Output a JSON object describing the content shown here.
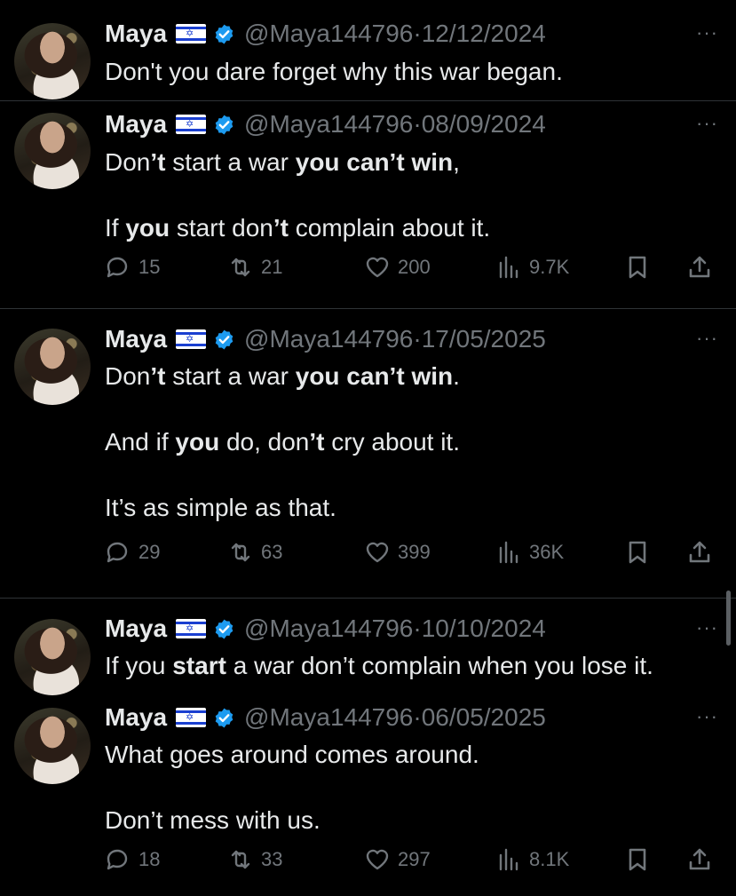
{
  "author": {
    "name": "Maya",
    "flag": "🇮🇱",
    "handle": "@Maya144796"
  },
  "tweets": [
    {
      "date": "12/12/2024",
      "lines": [
        [
          {
            "t": "Don't you dare forget why this war began.",
            "b": false
          }
        ]
      ]
    },
    {
      "date": "08/09/2024",
      "lines": [
        [
          {
            "t": "Don",
            "b": false
          },
          {
            "t": "’t",
            "b": true
          },
          {
            "t": " start a war ",
            "b": false
          },
          {
            "t": "you can’t win",
            "b": true
          },
          {
            "t": ",",
            "b": false
          }
        ],
        [],
        [
          {
            "t": "If ",
            "b": false
          },
          {
            "t": "you",
            "b": true
          },
          {
            "t": " start don",
            "b": false
          },
          {
            "t": "’t",
            "b": true
          },
          {
            "t": " complain about it.",
            "b": false
          }
        ]
      ],
      "stats": {
        "replies": "15",
        "reposts": "21",
        "likes": "200",
        "views": "9.7K"
      }
    },
    {
      "date": "17/05/2025",
      "lines": [
        [
          {
            "t": "Don",
            "b": false
          },
          {
            "t": "’t",
            "b": true
          },
          {
            "t": " start a war ",
            "b": false
          },
          {
            "t": "you can’t win",
            "b": true
          },
          {
            "t": ".",
            "b": false
          }
        ],
        [],
        [
          {
            "t": "And if ",
            "b": false
          },
          {
            "t": "you",
            "b": true
          },
          {
            "t": " do, don",
            "b": false
          },
          {
            "t": "’t",
            "b": true
          },
          {
            "t": " cry about it.",
            "b": false
          }
        ],
        [],
        [
          {
            "t": "It’s as simple as that.",
            "b": false
          }
        ]
      ],
      "stats": {
        "replies": "29",
        "reposts": "63",
        "likes": "399",
        "views": "36K"
      }
    },
    {
      "date": "10/10/2024",
      "lines": [
        [
          {
            "t": "If you ",
            "b": false
          },
          {
            "t": "start",
            "b": true
          },
          {
            "t": " a war don’t complain when you lose it.",
            "b": false
          }
        ]
      ]
    },
    {
      "date": "06/05/2025",
      "lines": [
        [
          {
            "t": "What goes around comes around.",
            "b": false
          }
        ],
        [],
        [
          {
            "t": "Don’t mess with us.",
            "b": false
          }
        ]
      ],
      "stats": {
        "replies": "18",
        "reposts": "33",
        "likes": "297",
        "views": "8.1K"
      }
    }
  ],
  "icons": {
    "verified_color": "#1d9bf0",
    "muted_color": "#71767b"
  },
  "separator": "·",
  "more_label": "···"
}
